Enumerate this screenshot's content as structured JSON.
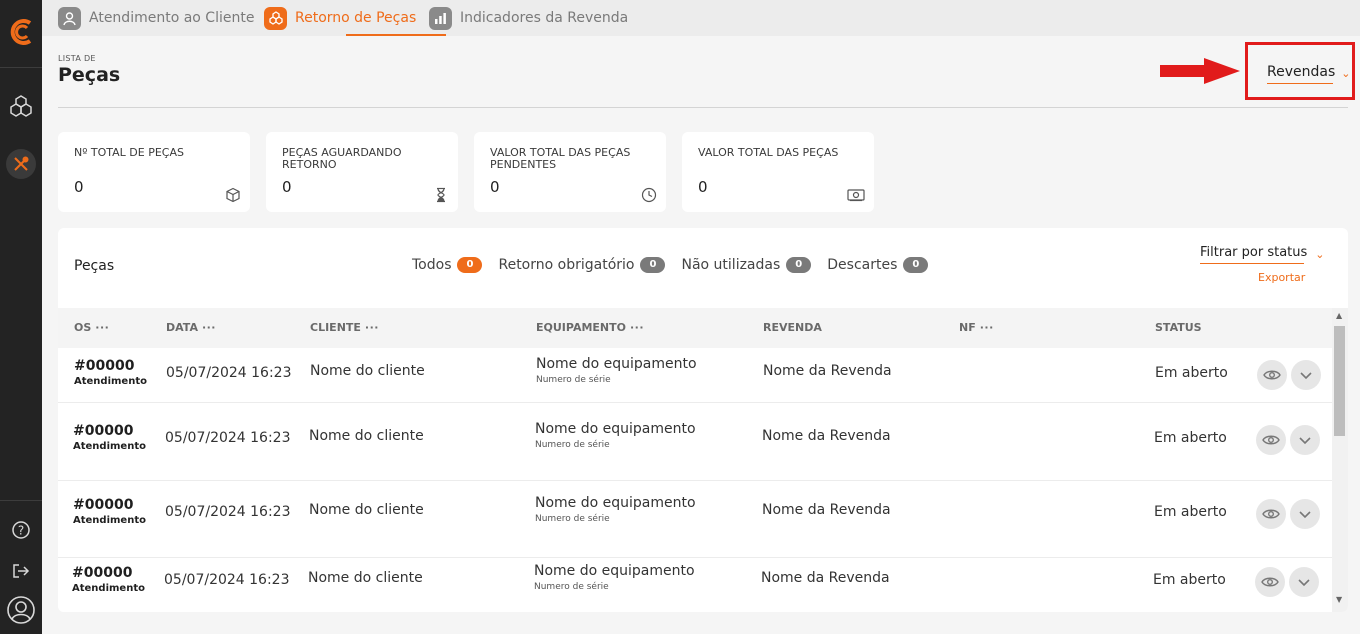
{
  "tabs": [
    {
      "label": "Atendimento ao Cliente",
      "active": false
    },
    {
      "label": "Retorno de Peças",
      "active": true
    },
    {
      "label": "Indicadores da Revenda",
      "active": false
    }
  ],
  "header": {
    "eyebrow": "LISTA DE",
    "title": "Peças"
  },
  "revendas": {
    "label": "Revendas"
  },
  "kpis": [
    {
      "label": "Nº TOTAL DE PEÇAS",
      "value": "0",
      "icon": "box-icon"
    },
    {
      "label": "PEÇAS AGUARDANDO RETORNO",
      "value": "0",
      "icon": "hourglass-icon"
    },
    {
      "label": "VALOR TOTAL DAS PEÇAS PENDENTES",
      "value": "0",
      "icon": "clock-icon"
    },
    {
      "label": "VALOR TOTAL DAS PEÇAS",
      "value": "0",
      "icon": "money-icon"
    }
  ],
  "panel": {
    "title": "Peças",
    "filters": [
      {
        "label": "Todos",
        "count": "0"
      },
      {
        "label": "Retorno obrigatório",
        "count": "0"
      },
      {
        "label": "Não utilizadas",
        "count": "0"
      },
      {
        "label": "Descartes",
        "count": "0"
      }
    ],
    "status_filter": "Filtrar por status",
    "export": "Exportar",
    "columns": {
      "os": "OS",
      "data": "DATA",
      "cliente": "CLIENTE",
      "equipamento": "EQUIPAMENTO",
      "revenda": "REVENDA",
      "nf": "NF",
      "status": "STATUS",
      "dots": "···"
    },
    "rows": [
      {
        "os": "#00000",
        "os_sub": "Atendimento",
        "data": "05/07/2024 16:23",
        "cliente": "Nome do cliente",
        "equipamento": "Nome do equipamento",
        "serie": "Numero de série",
        "revenda": "Nome da Revenda",
        "nf": "",
        "status": "Em aberto"
      },
      {
        "os": "#00000",
        "os_sub": "Atendimento",
        "data": "05/07/2024 16:23",
        "cliente": "Nome do cliente",
        "equipamento": "Nome do equipamento",
        "serie": "Numero de série",
        "revenda": "Nome da Revenda",
        "nf": "",
        "status": "Em aberto"
      },
      {
        "os": "#00000",
        "os_sub": "Atendimento",
        "data": "05/07/2024 16:23",
        "cliente": "Nome do cliente",
        "equipamento": "Nome do equipamento",
        "serie": "Numero de série",
        "revenda": "Nome da Revenda",
        "nf": "",
        "status": "Em aberto"
      },
      {
        "os": "#00000",
        "os_sub": "Atendimento",
        "data": "05/07/2024 16:23",
        "cliente": "Nome do cliente",
        "equipamento": "Nome do equipamento",
        "serie": "Numero de série",
        "revenda": "Nome da Revenda",
        "nf": "",
        "status": "Em aberto"
      }
    ]
  },
  "colors": {
    "accent": "#ef6c1a",
    "highlight": "#e11b1b",
    "sidebar": "#232323"
  }
}
